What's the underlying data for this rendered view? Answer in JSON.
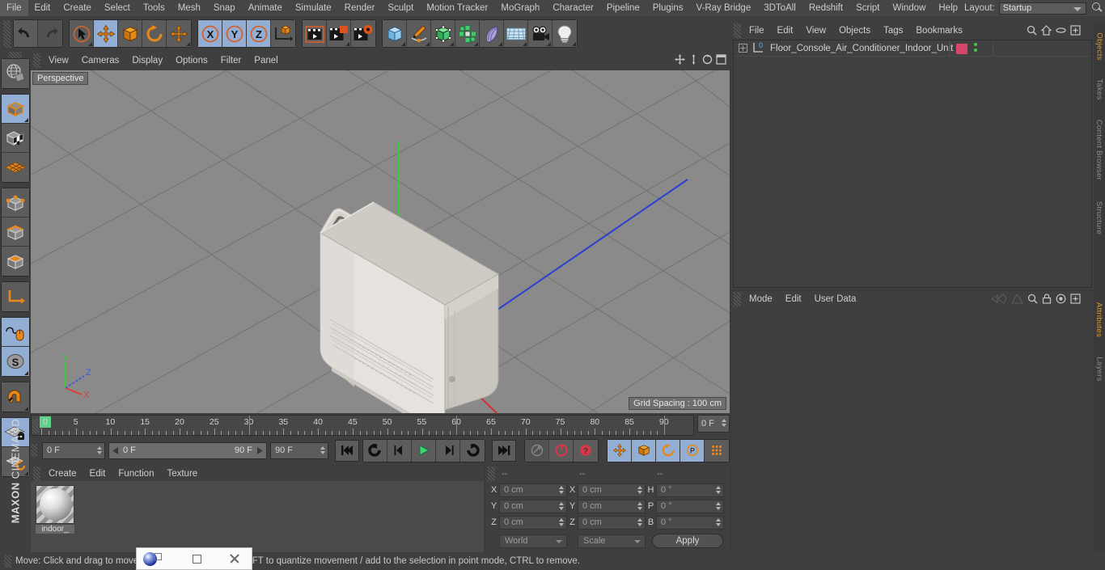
{
  "app": {
    "brand_maxon": "MAXON",
    "brand_product": "CINEMA 4D"
  },
  "menubar": {
    "items": [
      "File",
      "Edit",
      "Create",
      "Select",
      "Tools",
      "Mesh",
      "Snap",
      "Animate",
      "Simulate",
      "Render",
      "Sculpt",
      "Motion Tracker",
      "MoGraph",
      "Character",
      "Pipeline",
      "Plugins",
      "V-Ray Bridge",
      "3DToAll",
      "Redshift",
      "Script",
      "Window",
      "Help"
    ],
    "layout_label": "Layout:",
    "layout_value": "Startup",
    "search_icon": "search-icon"
  },
  "toolbar": {
    "groups": [
      {
        "name": "undo-redo",
        "buttons": [
          {
            "name": "undo-button",
            "icon": "undo-arrow-icon",
            "selected": false,
            "dim": false
          },
          {
            "name": "redo-button",
            "icon": "redo-arrow-icon",
            "selected": false,
            "dim": true
          }
        ]
      },
      {
        "name": "transform-tools",
        "buttons": [
          {
            "name": "live-selection-tool",
            "icon": "cursor-circle-icon",
            "selected": false,
            "dim": false,
            "corner": true
          },
          {
            "name": "move-tool",
            "icon": "move-arrows-icon",
            "selected": true,
            "dim": false
          },
          {
            "name": "scale-tool",
            "icon": "scale-box-icon",
            "selected": false,
            "dim": false
          },
          {
            "name": "rotate-tool",
            "icon": "rotate-circle-icon",
            "selected": false,
            "dim": false
          },
          {
            "name": "dynamic-place-tool",
            "icon": "move-arrows-icon",
            "selected": false,
            "dim": false,
            "corner": true
          }
        ]
      },
      {
        "name": "axis-locks",
        "buttons": [
          {
            "name": "lock-x-axis-button",
            "icon": "x-axis-icon",
            "selected": true,
            "dim": false
          },
          {
            "name": "lock-y-axis-button",
            "icon": "y-axis-icon",
            "selected": true,
            "dim": false
          },
          {
            "name": "lock-z-axis-button",
            "icon": "z-axis-icon",
            "selected": true,
            "dim": false
          },
          {
            "name": "world-object-axis-button",
            "icon": "world-axis-cube-icon",
            "selected": false,
            "dim": false
          }
        ]
      },
      {
        "name": "render-tools",
        "buttons": [
          {
            "name": "render-view-button",
            "icon": "clapper-view-icon",
            "selected": false,
            "dim": false
          },
          {
            "name": "render-to-picture-viewer-button",
            "icon": "clapper-picture-icon",
            "selected": false,
            "dim": false,
            "corner": true
          },
          {
            "name": "render-settings-button",
            "icon": "clapper-gear-icon",
            "selected": false,
            "dim": false
          }
        ]
      },
      {
        "name": "create-objects",
        "buttons": [
          {
            "name": "add-cube-button",
            "icon": "cube-blue-icon",
            "selected": false,
            "dim": false,
            "corner": true
          },
          {
            "name": "add-spline-button",
            "icon": "pen-spline-icon",
            "selected": false,
            "dim": false,
            "corner": true
          },
          {
            "name": "add-generator-button",
            "icon": "green-cube-icon",
            "selected": false,
            "dim": false,
            "corner": true
          },
          {
            "name": "add-array-button",
            "icon": "green-cluster-icon",
            "selected": false,
            "dim": false,
            "corner": true
          },
          {
            "name": "add-deformer-button",
            "icon": "bend-deformer-icon",
            "selected": false,
            "dim": false,
            "corner": true
          },
          {
            "name": "add-environment-button",
            "icon": "floor-grid-icon",
            "selected": false,
            "dim": false,
            "corner": true
          },
          {
            "name": "add-camera-button",
            "icon": "camera-icon",
            "selected": false,
            "dim": false,
            "corner": true
          },
          {
            "name": "add-light-button",
            "icon": "lightbulb-icon",
            "selected": false,
            "dim": false,
            "corner": true
          }
        ]
      }
    ]
  },
  "leftbar": {
    "groups": [
      {
        "name": "world-grid-group",
        "buttons": [
          {
            "name": "make-editable-button",
            "icon": "globe-wire-icon",
            "selected": false
          }
        ]
      },
      {
        "name": "mode-group-1",
        "buttons": [
          {
            "name": "model-mode-button",
            "icon": "model-cube-icon",
            "selected": true,
            "corner": true
          },
          {
            "name": "texture-mode-button",
            "icon": "texture-cube-icon",
            "selected": false
          },
          {
            "name": "workplane-mode-button",
            "icon": "workplane-grid-icon",
            "selected": false
          }
        ]
      },
      {
        "name": "component-group",
        "buttons": [
          {
            "name": "points-mode-button",
            "icon": "points-cube-icon",
            "selected": false
          },
          {
            "name": "edges-mode-button",
            "icon": "edges-cube-icon",
            "selected": false
          },
          {
            "name": "polygons-mode-button",
            "icon": "polygons-cube-icon",
            "selected": false
          }
        ]
      },
      {
        "name": "axis-group",
        "buttons": [
          {
            "name": "enable-axis-button",
            "icon": "axis-corner-icon",
            "selected": false
          }
        ]
      },
      {
        "name": "snap-group",
        "buttons": [
          {
            "name": "viewport-solo-button",
            "icon": "mouse-spline-icon",
            "selected": true
          },
          {
            "name": "soft-selection-button",
            "icon": "s-sphere-icon",
            "selected": true,
            "corner": true
          }
        ]
      },
      {
        "name": "magnet-group",
        "buttons": [
          {
            "name": "enable-snap-button",
            "icon": "magnet-icon",
            "selected": false,
            "corner": true
          }
        ]
      },
      {
        "name": "workplane-group",
        "buttons": [
          {
            "name": "lock-workplane-button",
            "icon": "grid-lock-icon",
            "selected": true
          },
          {
            "name": "planar-workplane-button",
            "icon": "grid-rotate-icon",
            "selected": false,
            "corner": true
          }
        ]
      }
    ]
  },
  "viewport": {
    "menu": [
      "View",
      "Cameras",
      "Display",
      "Options",
      "Filter",
      "Panel"
    ],
    "perspective_label": "Perspective",
    "grid_spacing_label": "Grid Spacing : 100 cm",
    "axis_gizmo": {
      "x": "X",
      "y": "Y",
      "z": "Z",
      "x_color": "#e03c3c",
      "y_color": "#3ec93e",
      "z_color": "#3c5ce0"
    },
    "panel_icons": [
      "pan-icon",
      "zoom-icon",
      "rotate-icon",
      "maximize-icon"
    ]
  },
  "timeline": {
    "ticks": [
      "0",
      "5",
      "10",
      "15",
      "20",
      "25",
      "30",
      "35",
      "40",
      "45",
      "50",
      "55",
      "60",
      "65",
      "70",
      "75",
      "80",
      "85",
      "90"
    ],
    "current_frame_field": "0 F",
    "current_frame_left": "0 F",
    "range_start": "0 F",
    "range_end": "90 F",
    "max_frame_field": "90 F",
    "transport": [
      {
        "name": "go-to-start-button",
        "icon": "skip-start-icon"
      },
      {
        "name": "play-backwards-button",
        "icon": "rewind-loop-icon"
      },
      {
        "name": "step-back-button",
        "icon": "prev-frame-icon"
      },
      {
        "name": "play-forward-button",
        "icon": "play-icon"
      },
      {
        "name": "step-forward-button",
        "icon": "next-frame-icon"
      },
      {
        "name": "loop-button",
        "icon": "loop-arrow-icon"
      },
      {
        "name": "go-to-end-button",
        "icon": "skip-end-icon"
      }
    ],
    "key_tools": [
      {
        "name": "record-active-objects-button",
        "icon": "key-icon",
        "selected": false
      },
      {
        "name": "autokeying-button",
        "icon": "red-circle-icon",
        "selected": false
      },
      {
        "name": "keyframe-selection-button",
        "icon": "red-question-icon",
        "selected": false
      }
    ],
    "record_toggles": [
      {
        "name": "position-key-toggle",
        "icon": "move-arrows-icon",
        "selected": true
      },
      {
        "name": "scale-key-toggle",
        "icon": "scale-box-icon",
        "selected": true
      },
      {
        "name": "rotation-key-toggle",
        "icon": "rotate-circle-icon",
        "selected": true
      },
      {
        "name": "parameter-key-toggle",
        "icon": "p-circle-icon",
        "selected": true
      },
      {
        "name": "point-level-animation-toggle",
        "icon": "dots-grid-icon",
        "selected": false
      },
      {
        "name": "timeline-filmstrip-button",
        "icon": "filmstrip-icon",
        "selected": true
      }
    ]
  },
  "material_manager": {
    "menu": [
      "Create",
      "Edit",
      "Function",
      "Texture"
    ],
    "materials": [
      {
        "name": "indoor_",
        "thumb": "sphere-preview"
      }
    ]
  },
  "coordinates": {
    "header_cols": [
      "--",
      "--",
      "--"
    ],
    "rows": [
      {
        "pos_label": "X",
        "pos_value": "0 cm",
        "size_label": "X",
        "size_value": "0 cm",
        "rot_label": "H",
        "rot_value": "0 °"
      },
      {
        "pos_label": "Y",
        "pos_value": "0 cm",
        "size_label": "Y",
        "size_value": "0 cm",
        "rot_label": "P",
        "rot_value": "0 °"
      },
      {
        "pos_label": "Z",
        "pos_value": "0 cm",
        "size_label": "Z",
        "size_value": "0 cm",
        "rot_label": "B",
        "rot_value": "0 °"
      }
    ],
    "coord_system": "World",
    "size_mode": "Scale",
    "apply_label": "Apply"
  },
  "object_manager": {
    "menu": [
      "File",
      "Edit",
      "View",
      "Objects",
      "Tags",
      "Bookmarks"
    ],
    "icons": [
      "search-icon",
      "home-icon",
      "ellipse-icon",
      "plus-box-icon"
    ],
    "objects": [
      {
        "name": "Floor_Console_Air_Conditioner_Indoor_Unit",
        "layer_number": "0",
        "tag_color": "#d6456a",
        "visible": true
      }
    ]
  },
  "attribute_manager": {
    "menu": [
      "Mode",
      "Edit",
      "User Data"
    ],
    "icons": [
      "prev-icon",
      "next-icon",
      "search-icon",
      "lock-icon",
      "target-icon",
      "plus-box-icon"
    ]
  },
  "right_tabs": [
    {
      "label": "Objects",
      "active": true
    },
    {
      "label": "Takes",
      "active": false
    },
    {
      "label": "Content Browser",
      "active": false
    },
    {
      "label": "Structure",
      "active": false
    },
    {
      "label": "Attributes",
      "active": true
    },
    {
      "label": "Layers",
      "active": false
    }
  ],
  "statusbar": {
    "message": "Move: Click and drag to move the selected elements. SHIFT to quantize movement / add to the selection in point mode, CTRL to remove."
  },
  "mini_window": {
    "icons": [
      "c4d-app-icon",
      "restore-icon",
      "maximize-icon",
      "close-icon"
    ]
  },
  "colors": {
    "accent_orange": "#e8871a",
    "selection_blue": "#93aed4",
    "panel_bg": "#3f3f3f",
    "viewport_bg": "#8a8a8a",
    "tab_active": "#d89a3c"
  }
}
